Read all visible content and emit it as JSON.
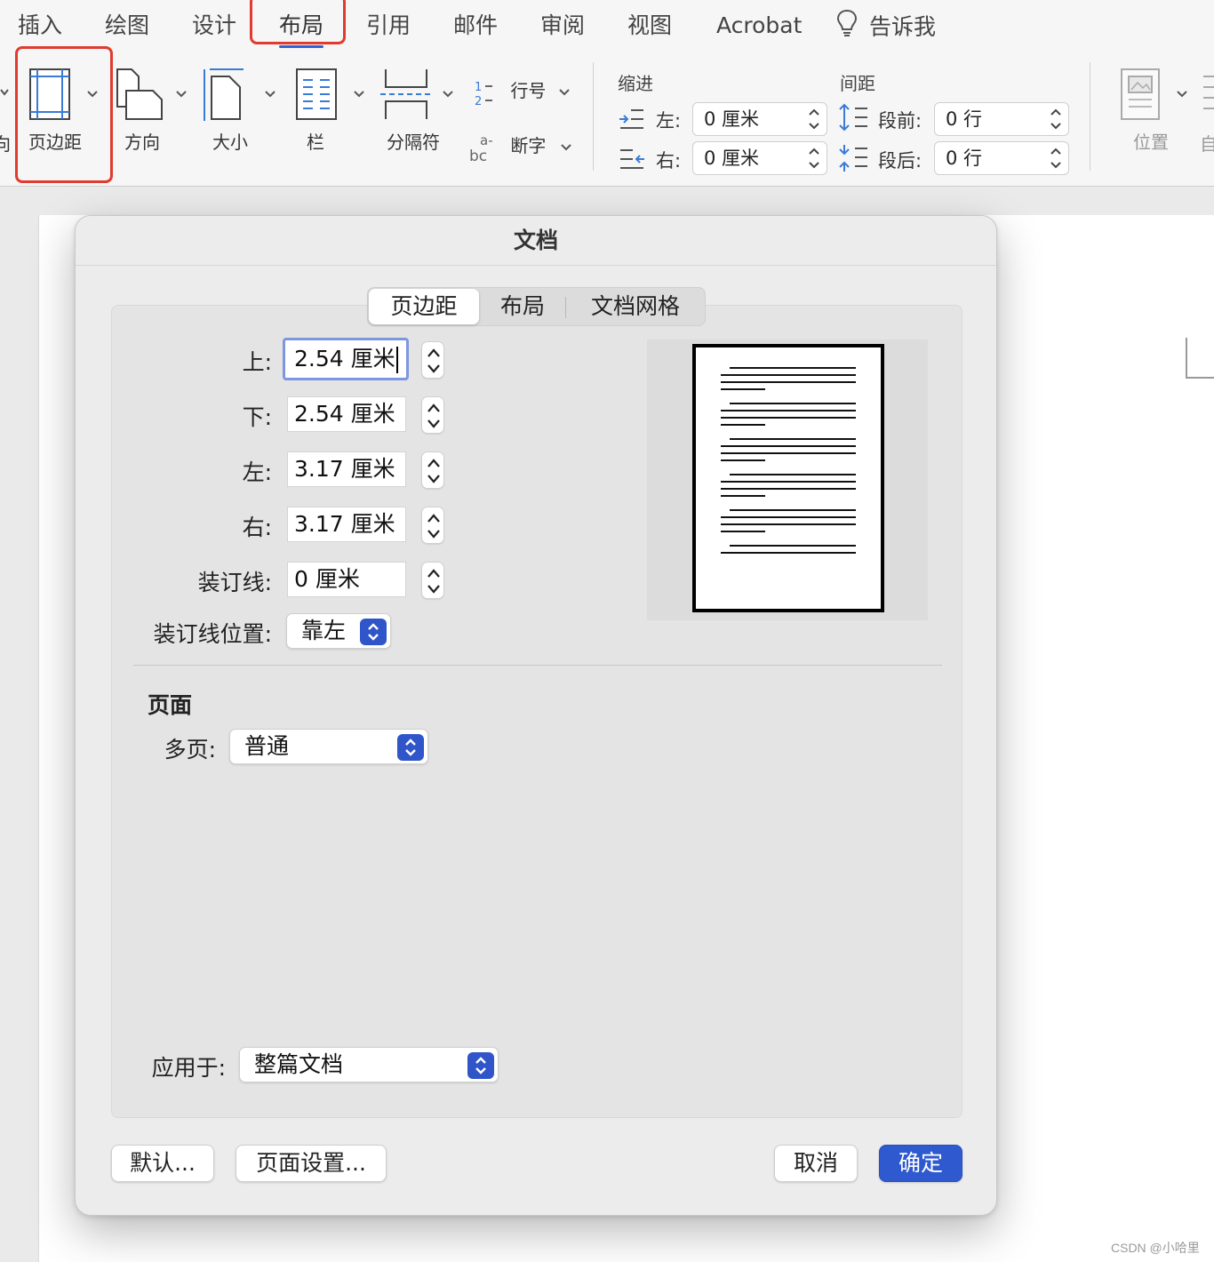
{
  "ribbon": {
    "tabs": [
      "插入",
      "绘图",
      "设计",
      "布局",
      "引用",
      "邮件",
      "审阅",
      "视图",
      "Acrobat",
      "告诉我"
    ],
    "active_tab": "布局",
    "buttons": {
      "margins": "页边距",
      "orientation": "方向",
      "size": "大小",
      "columns": "栏",
      "breaks": "分隔符",
      "line_numbers": "行号",
      "hyphenation": "断字",
      "position": "位置",
      "left_cut": "向",
      "right_cut": "自"
    },
    "indent": {
      "title": "缩进",
      "left_label": "左:",
      "left_value": "0 厘米",
      "right_label": "右:",
      "right_value": "0 厘米"
    },
    "spacing": {
      "title": "间距",
      "before_label": "段前:",
      "before_value": "0 行",
      "after_label": "段后:",
      "after_value": "0 行"
    }
  },
  "dialog": {
    "title": "文档",
    "tabs": [
      "页边距",
      "布局",
      "文档网格"
    ],
    "active_tab": "页边距",
    "margins": {
      "top_label": "上:",
      "top_value": "2.54 厘米",
      "bottom_label": "下:",
      "bottom_value": "2.54 厘米",
      "left_label": "左:",
      "left_value": "3.17 厘米",
      "right_label": "右:",
      "right_value": "3.17 厘米",
      "gutter_label": "装订线:",
      "gutter_value": "0 厘米",
      "gutter_pos_label": "装订线位置:",
      "gutter_pos_value": "靠左"
    },
    "pages": {
      "section_title": "页面",
      "multiple_label": "多页:",
      "multiple_value": "普通"
    },
    "apply": {
      "label": "应用于:",
      "value": "整篇文档"
    },
    "buttons": {
      "default": "默认...",
      "page_setup": "页面设置...",
      "cancel": "取消",
      "ok": "确定"
    }
  },
  "watermark": "CSDN @小哈里",
  "colors": {
    "accent": "#2f59cf",
    "highlight": "#e03b2e",
    "focus_ring": "#7d96e0"
  }
}
